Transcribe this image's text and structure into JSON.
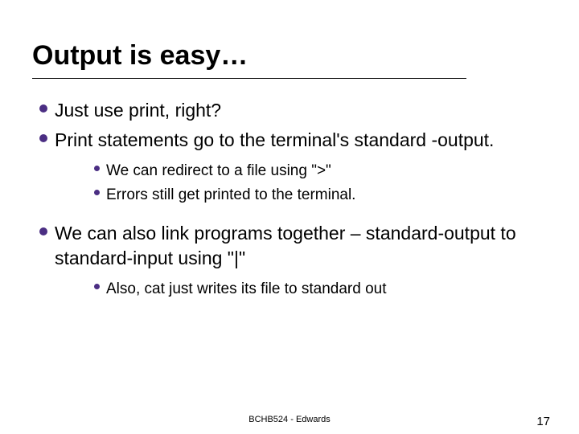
{
  "title": "Output is easy…",
  "bullets": {
    "b1": "Just use print, right?",
    "b2": "Print statements go to the terminal's standard -output.",
    "b2_subs": {
      "s1": "We can redirect to a file using \">\"",
      "s2": "Errors still get printed to the terminal."
    },
    "b3": "We can also link programs together – standard-output to standard-input using \"|\"",
    "b3_subs": {
      "s1": "Also, cat just writes its file to standard out"
    }
  },
  "footer": {
    "center": "BCHB524 - Edwards",
    "page": "17"
  }
}
